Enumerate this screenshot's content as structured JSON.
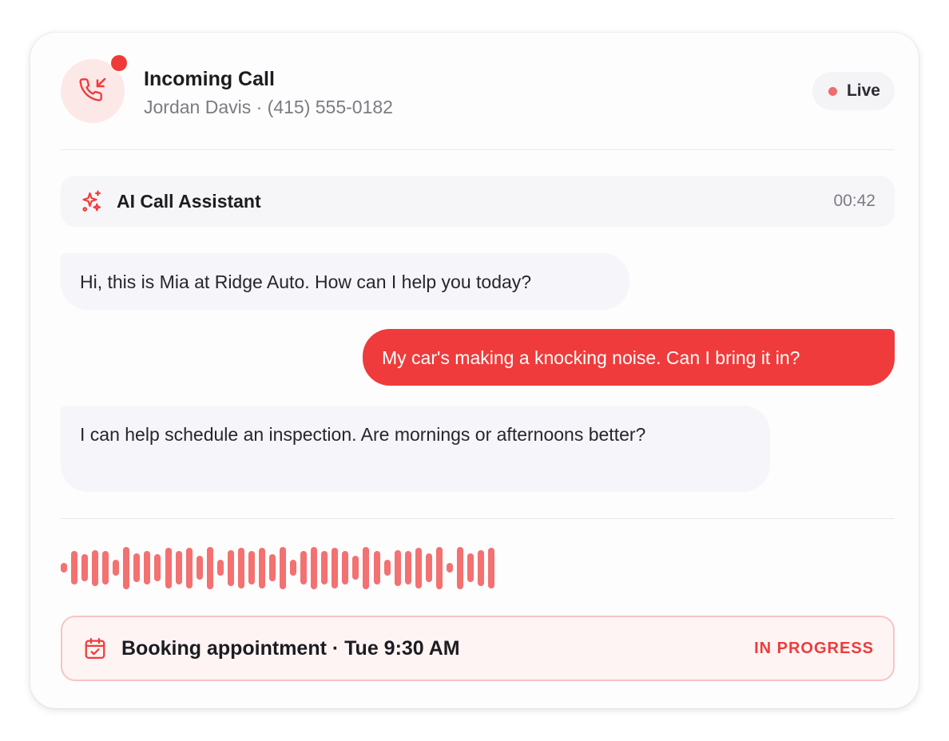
{
  "header": {
    "title": "Incoming Call",
    "caller": "Jordan Davis · (415) 555-0182",
    "live_label": "Live"
  },
  "assistant": {
    "name": "AI Call Assistant",
    "timer": "00:42",
    "icon": "sparkles-icon"
  },
  "messages": [
    {
      "from": "assistant",
      "text": "Hi, this is Mia at Ridge Auto. How can I help you today?"
    },
    {
      "from": "caller",
      "text": "My car's making a knocking noise. Can I bring it in?"
    },
    {
      "from": "assistant",
      "text": "I can help schedule an inspection. Are mornings or afternoons better?"
    }
  ],
  "booking": {
    "text": "Booking appointment · Tue 9:30 AM",
    "status": "IN PROGRESS",
    "icon": "calendar-check-icon"
  },
  "waveform": {
    "levels": [
      0.2,
      0.72,
      0.58,
      0.78,
      0.72,
      0.35,
      0.92,
      0.62,
      0.72,
      0.58,
      0.88,
      0.72,
      0.88,
      0.52,
      0.92,
      0.35,
      0.78,
      0.88,
      0.72,
      0.88,
      0.58,
      0.92,
      0.35,
      0.72,
      0.92,
      0.72,
      0.88,
      0.72,
      0.52,
      0.92,
      0.72,
      0.35,
      0.78,
      0.72,
      0.88,
      0.62,
      0.92,
      0.2,
      0.92,
      0.62,
      0.78,
      0.88
    ]
  },
  "colors": {
    "accent": "#ef3b3b",
    "accent_soft": "#fde8e8",
    "wave": "#f37171",
    "live_dot": "#f06b6b"
  }
}
